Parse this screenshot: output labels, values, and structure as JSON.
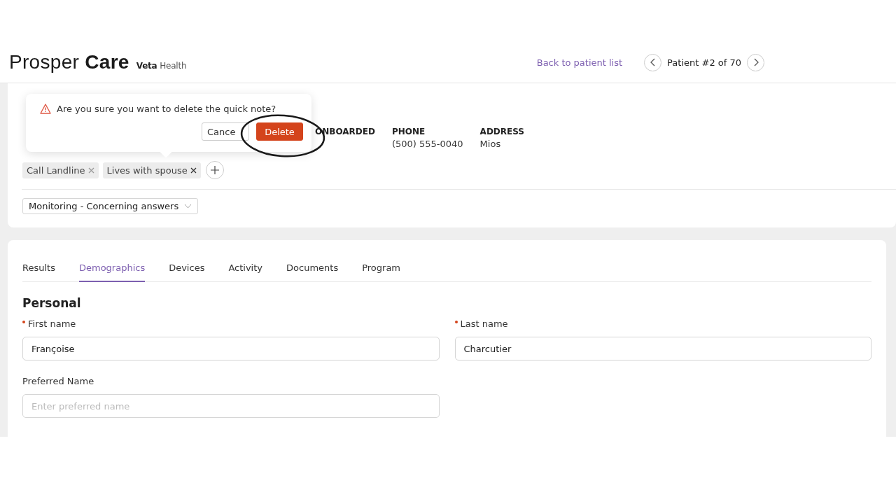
{
  "header": {
    "logo": "Prosper **Care**",
    "sub_logo": "**Veta** Health",
    "back_link": "Back to patient list",
    "pager": "Patient #2 of 70"
  },
  "patient": {
    "fields": [
      {
        "label": "ONBOARDED"
      },
      {
        "label": "PHONE",
        "value": "(500) 555-0040"
      },
      {
        "label": "ADDRESS",
        "value": "Mios"
      }
    ],
    "tags": [
      {
        "label": "Call Landline"
      },
      {
        "label": "Lives with spouse"
      }
    ],
    "status_dropdown": "Monitoring - Concerning answers"
  },
  "popover": {
    "message": "Are you sure you want to delete the quick note?",
    "buttons": [
      {
        "label": "Cance",
        "kind": "secondary"
      },
      {
        "label": "Delete",
        "kind": "danger"
      }
    ]
  },
  "annotation": {
    "kind": "circle"
  },
  "tabs": [
    {
      "label": "Results",
      "selected": false
    },
    {
      "label": "Demographics",
      "selected": true
    },
    {
      "label": "Devices",
      "selected": false
    },
    {
      "label": "Activity",
      "selected": false
    },
    {
      "label": "Documents",
      "selected": false
    },
    {
      "label": "Program",
      "selected": false
    }
  ],
  "section": {
    "title": "Personal",
    "fields": [
      {
        "label": "First name",
        "required": true,
        "value": "Françoise"
      },
      {
        "label": "Last name",
        "required": true,
        "value": "Charcutier"
      },
      {
        "label": "Preferred Name",
        "required": false,
        "placeholder": "Enter preferred name"
      }
    ]
  }
}
